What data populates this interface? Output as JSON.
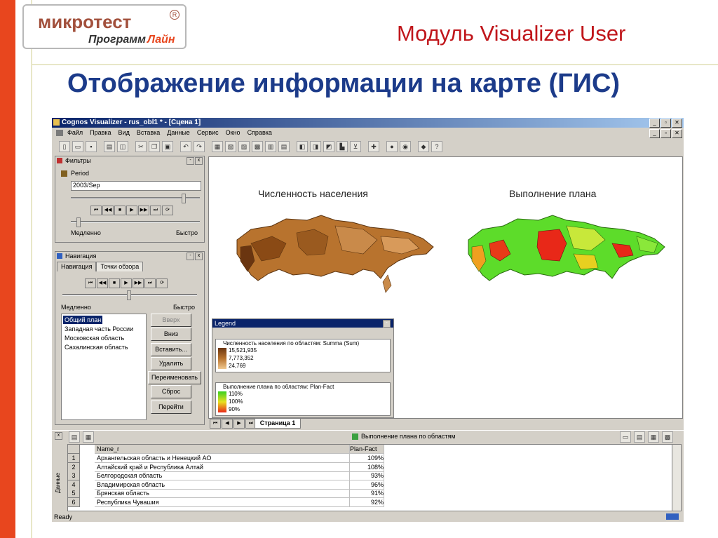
{
  "slide": {
    "logo_main": "микротест",
    "logo_r": "R",
    "logo_sub1": "Программ",
    "logo_sub2": "Лайн",
    "module": "Модуль Visualizer User",
    "title": "Отображение информации на карте (ГИС)"
  },
  "window": {
    "title": "Cognos Visualizer - rus_obl1 * - [Сцена 1]",
    "menu": [
      "Файл",
      "Правка",
      "Вид",
      "Вставка",
      "Данные",
      "Сервис",
      "Окно",
      "Справка"
    ],
    "status": "Ready"
  },
  "filters": {
    "header": "Фильтры",
    "period_label": "Period",
    "period_value": "2003/Sep",
    "slow": "Медленно",
    "fast": "Быстро"
  },
  "navigation": {
    "header": "Навигация",
    "tabs": [
      "Навигация",
      "Точки обзора"
    ],
    "slow": "Медленно",
    "fast": "Быстро",
    "items": [
      "Общий план",
      "Западная часть России",
      "Московская область",
      "Сахалинская область"
    ],
    "buttons": [
      "Вверх",
      "Вниз",
      "Вставить...",
      "Удалить",
      "Переименовать",
      "Сброс",
      "Перейти"
    ]
  },
  "maps": {
    "left_title": "Численность населения",
    "right_title": "Выполнение плана"
  },
  "legend": {
    "header": "Legend",
    "box1_title": "Численность населения по областям: Summa (Sum)",
    "box1_values": [
      "15,521,935",
      "7,773,352",
      "24,769"
    ],
    "box2_title": "Выполнение плана по областям: Plan-Fact",
    "box2_values": [
      "110%",
      "100%",
      "90%"
    ]
  },
  "page_tab": "Страница 1",
  "data_panel": {
    "title": "Выполнение плана по областям",
    "side_label": "Данные",
    "col_name": "Name_r",
    "col_value": "Plan-Fact",
    "rows": [
      {
        "n": "1",
        "name": "Архангельская область и Ненецкий АО",
        "value": "109%"
      },
      {
        "n": "2",
        "name": "Алтайский край и Республика Алтай",
        "value": "108%"
      },
      {
        "n": "3",
        "name": "Белгородская область",
        "value": "93%"
      },
      {
        "n": "4",
        "name": "Владимирская область",
        "value": "96%"
      },
      {
        "n": "5",
        "name": "Брянская область",
        "value": "91%"
      },
      {
        "n": "6",
        "name": "Республика Чувашия",
        "value": "92%"
      }
    ]
  },
  "colors": {
    "accent_red": "#c0161b",
    "title_blue": "#1c3b8a",
    "side_orange": "#e8461e"
  }
}
